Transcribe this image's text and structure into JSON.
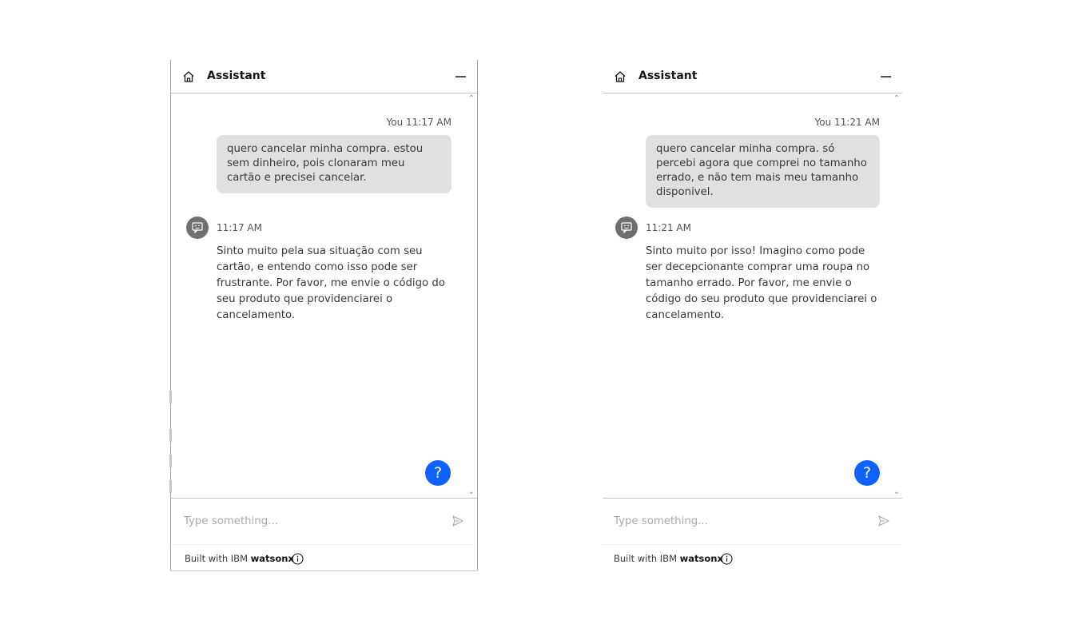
{
  "widgets": [
    {
      "header": {
        "title": "Assistant",
        "home_icon": "home-icon",
        "minimize_icon": "minimize-icon"
      },
      "user_message": {
        "sender": "You",
        "time": "11:17 AM",
        "text": "quero cancelar minha compra. estou sem dinheiro, pois clonaram meu cartão e precisei cancelar."
      },
      "bot_message": {
        "time": "11:17 AM",
        "text": "Sinto muito pela sua situação com seu cartão, e entendo como isso pode ser frustrante. Por favor, me envie o código do seu produto que providenciarei o cancelamento."
      },
      "help_button": "?",
      "input": {
        "placeholder": "Type something...",
        "value": ""
      },
      "footer": {
        "prefix": "Built with IBM",
        "brand": "watsonx"
      }
    },
    {
      "header": {
        "title": "Assistant",
        "home_icon": "home-icon",
        "minimize_icon": "minimize-icon"
      },
      "user_message": {
        "sender": "You",
        "time": "11:21 AM",
        "text": "quero cancelar minha compra. só percebi agora que comprei no tamanho errado, e não tem mais meu tamanho disponivel."
      },
      "bot_message": {
        "time": "11:21 AM",
        "text": "Sinto muito por isso! Imagino como pode ser decepcionante comprar uma roupa no tamanho errado. Por favor, me envie o código do seu produto que providenciarei o cancelamento."
      },
      "help_button": "?",
      "input": {
        "placeholder": "Type something...",
        "value": ""
      },
      "footer": {
        "prefix": "Built with IBM",
        "brand": "watsonx"
      }
    }
  ],
  "colors": {
    "accent": "#0f62fe",
    "bubble": "#e0e0e0",
    "avatar": "#6f6f6f",
    "divider": "#c6c6c6"
  }
}
